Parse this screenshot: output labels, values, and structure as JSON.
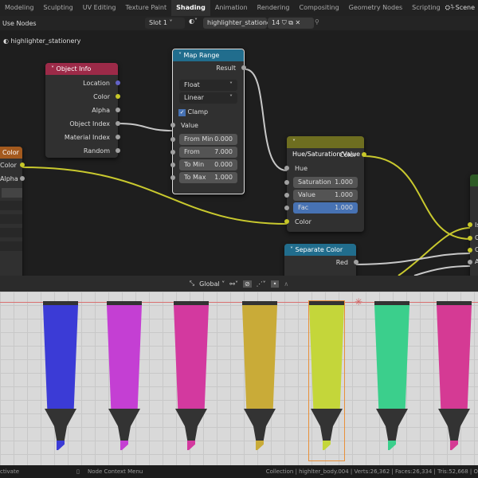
{
  "tabs": [
    "Modeling",
    "Sculpting",
    "UV Editing",
    "Texture Paint",
    "Shading",
    "Animation",
    "Rendering",
    "Compositing",
    "Geometry Nodes",
    "Scripting",
    "+"
  ],
  "active_tab": "Shading",
  "scene": "Scene",
  "header": {
    "use_nodes": "Use Nodes",
    "slot": "Slot 1",
    "material": "highlighter_stationery",
    "users": "14"
  },
  "breadcrumb": "highlighter_stationery",
  "nodes": {
    "object_info": {
      "title": "Object Info",
      "outputs": [
        "Location",
        "Color",
        "Alpha",
        "Object Index",
        "Material Index",
        "Random"
      ]
    },
    "map_range": {
      "title": "Map Range",
      "result": "Result",
      "type": "Float",
      "interp": "Linear",
      "clamp": "Clamp",
      "value": "Value",
      "fields": [
        {
          "label": "From Min",
          "value": "0.000"
        },
        {
          "label": "From Max",
          "value": "7.000"
        },
        {
          "label": "To Min",
          "value": "0.000"
        },
        {
          "label": "To Max",
          "value": "1.000"
        }
      ]
    },
    "color_attr": {
      "title": "Color",
      "outputs": [
        "Color",
        "Alpha"
      ]
    },
    "hsv": {
      "title": "Hue/Saturation/Value",
      "out": "Color",
      "hue": "Hue",
      "fields": [
        {
          "label": "Saturation",
          "value": "1.000"
        },
        {
          "label": "Value",
          "value": "1.000"
        },
        {
          "label": "Fac",
          "value": "1.000"
        }
      ],
      "color_in": "Color"
    },
    "separate": {
      "title": "Separate Color",
      "out": "Red"
    },
    "partial_inputs": [
      "Is",
      "C",
      "C",
      "A"
    ]
  },
  "viewport_header": {
    "orientation": "Global"
  },
  "markers": [
    "#3b3bd6",
    "#c43fd3",
    "#d3399f",
    "#c9ab38",
    "#c4d63a",
    "#3bcf8c",
    "#d53a94"
  ],
  "status": {
    "left": "ctivate",
    "middle": "Node Context Menu",
    "right": "Collection | highlter_body.004 | Verts:26,362 | Faces:26,334 | Tris:52,668 | O"
  }
}
